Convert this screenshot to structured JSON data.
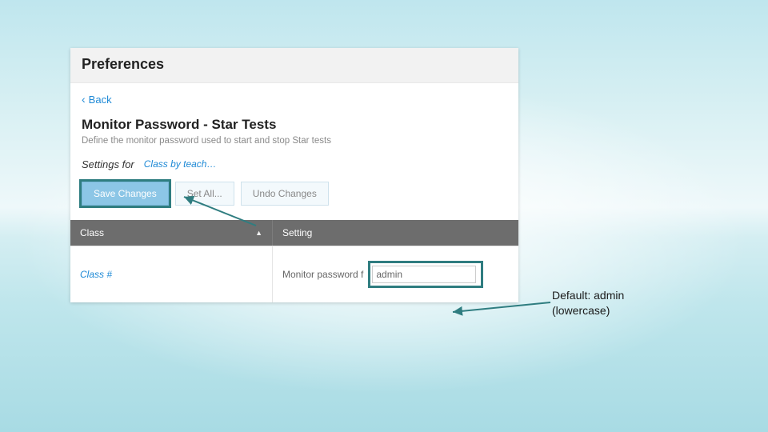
{
  "panel": {
    "title": "Preferences",
    "back_label": "Back",
    "subtitle": "Monitor Password - Star Tests",
    "description": "Define the monitor password used to start and stop Star tests",
    "settings_for_label": "Settings for",
    "scope_value": "Class by teach…"
  },
  "buttons": {
    "save": "Save Changes",
    "set_all": "Set All...",
    "undo": "Undo Changes"
  },
  "table": {
    "col_class": "Class",
    "col_setting": "Setting",
    "row": {
      "class_label": "Class   #",
      "setting_label": "Monitor password f",
      "password_value": "admin"
    }
  },
  "annotation": {
    "line1": "Default: admin",
    "line2": "(lowercase)"
  },
  "colors": {
    "highlight": "#2f7d80",
    "link": "#1f8ad6"
  }
}
